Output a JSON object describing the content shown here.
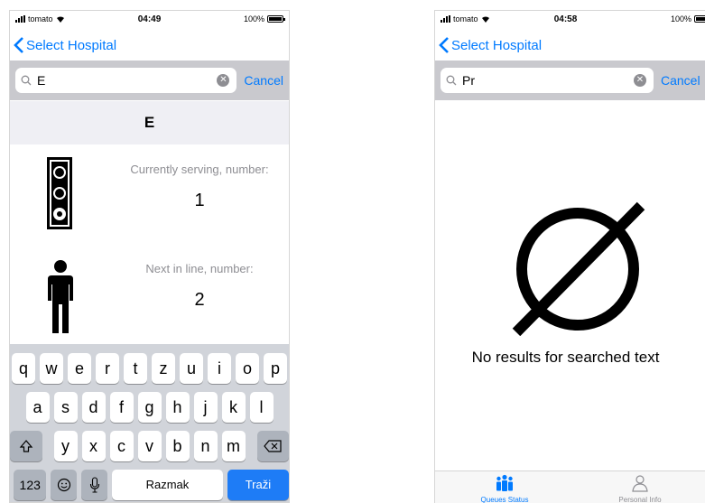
{
  "left_screen": {
    "status": {
      "carrier": "tomato",
      "time": "04:49",
      "battery": "100%"
    },
    "nav": {
      "back_label": "Select Hospital"
    },
    "search": {
      "value": "E",
      "cancel": "Cancel"
    },
    "section_title": "E",
    "current": {
      "label": "Currently serving, number:",
      "number": "1"
    },
    "next": {
      "label": "Next in line, number:",
      "number": "2"
    },
    "keyboard": {
      "row1": [
        "q",
        "w",
        "e",
        "r",
        "t",
        "z",
        "u",
        "i",
        "o",
        "p"
      ],
      "row2": [
        "a",
        "s",
        "d",
        "f",
        "g",
        "h",
        "j",
        "k",
        "l"
      ],
      "row3": [
        "y",
        "x",
        "c",
        "v",
        "b",
        "n",
        "m"
      ],
      "numbers_key": "123",
      "space_key": "Razmak",
      "return_key": "Traži"
    }
  },
  "right_screen": {
    "status": {
      "carrier": "tomato",
      "time": "04:58",
      "battery": "100%"
    },
    "nav": {
      "back_label": "Select Hospital"
    },
    "search": {
      "value": "Pr",
      "cancel": "Cancel"
    },
    "empty_message": "No results for searched text",
    "tabs": [
      {
        "label": "Queues Status",
        "icon": "people-icon",
        "color": "#007aff"
      },
      {
        "label": "Personal Info",
        "icon": "person-icon",
        "color": "#8e8e93"
      }
    ]
  }
}
